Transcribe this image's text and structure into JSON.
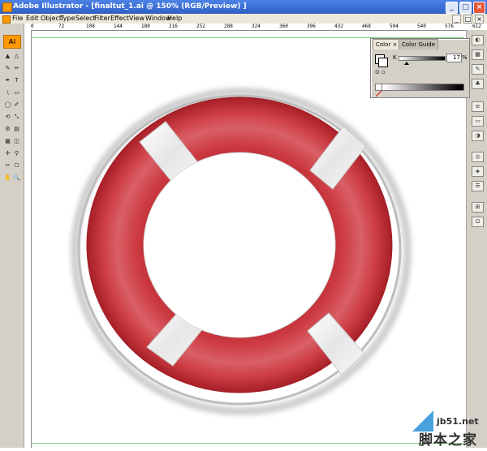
{
  "window": {
    "title": "Adobe Illustrator - [finaltut_1.ai @ 150% (RGB/Preview) ]",
    "minimize": "_",
    "maximize": "□",
    "close": "×"
  },
  "menu": [
    "File",
    "Edit",
    "Object",
    "Type",
    "Select",
    "Filter",
    "Effect",
    "View",
    "Window",
    "Help"
  ],
  "toolbar": {
    "logo": "Ai",
    "tools": [
      "▲",
      "△",
      "✎",
      "✏",
      "✒",
      "T",
      "\\",
      "▭",
      "◯",
      "✐",
      "⟲",
      "⤡",
      "⚙",
      "▤",
      "▦",
      "◫",
      "✢",
      "⚲",
      "✂",
      "☐",
      "✋",
      "🔍"
    ]
  },
  "ruler": {
    "top_labels": [
      "0",
      "72",
      "108",
      "144",
      "180",
      "216",
      "252",
      "288",
      "324",
      "360",
      "396",
      "432",
      "468",
      "504",
      "540",
      "576",
      "612"
    ]
  },
  "color_panel": {
    "tab_active": "Color",
    "tab_inactive": "Color Guide",
    "k_label": "K",
    "k_value": "17",
    "k_unit": "%"
  },
  "lifebuoy": {
    "ring_color": "#cd3c43",
    "ring_highlight": "#e7868a",
    "band_color": "#f2f2f2",
    "outline_color": "#bdbdbd"
  },
  "watermark": {
    "domain": "jb51.net",
    "cn": "脚本之家"
  }
}
